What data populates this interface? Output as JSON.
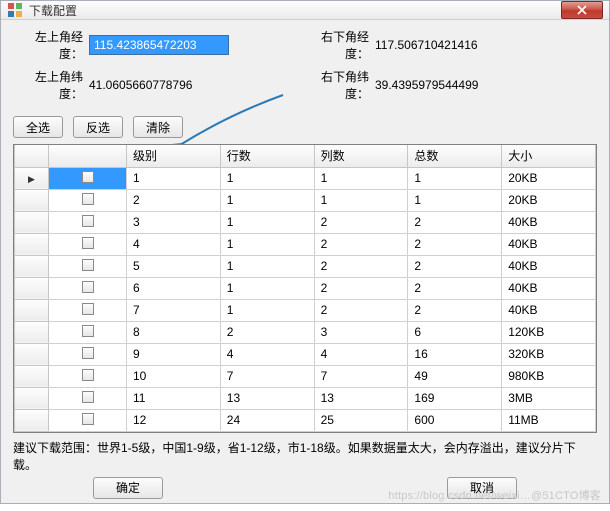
{
  "window": {
    "title": "下载配置"
  },
  "coords": {
    "tl_lon_label": "左上角经度：",
    "tl_lon_value": "115.423865472203",
    "tl_lat_label": "左上角纬度：",
    "tl_lat_value": "41.0605660778796",
    "br_lon_label": "右下角经度：",
    "br_lon_value": "117.506710421416",
    "br_lat_label": "右下角纬度：",
    "br_lat_value": "39.4395979544499"
  },
  "toolbar": {
    "select_all": "全选",
    "invert_select": "反选",
    "clear": "清除"
  },
  "table": {
    "headers": {
      "level": "级别",
      "rows": "行数",
      "cols": "列数",
      "total": "总数",
      "size": "大小"
    },
    "rows": [
      {
        "level": "1",
        "rows": "1",
        "cols": "1",
        "total": "1",
        "size": "20KB"
      },
      {
        "level": "2",
        "rows": "1",
        "cols": "1",
        "total": "1",
        "size": "20KB"
      },
      {
        "level": "3",
        "rows": "1",
        "cols": "2",
        "total": "2",
        "size": "40KB"
      },
      {
        "level": "4",
        "rows": "1",
        "cols": "2",
        "total": "2",
        "size": "40KB"
      },
      {
        "level": "5",
        "rows": "1",
        "cols": "2",
        "total": "2",
        "size": "40KB"
      },
      {
        "level": "6",
        "rows": "1",
        "cols": "2",
        "total": "2",
        "size": "40KB"
      },
      {
        "level": "7",
        "rows": "1",
        "cols": "2",
        "total": "2",
        "size": "40KB"
      },
      {
        "level": "8",
        "rows": "2",
        "cols": "3",
        "total": "6",
        "size": "120KB"
      },
      {
        "level": "9",
        "rows": "4",
        "cols": "4",
        "total": "16",
        "size": "320KB"
      },
      {
        "level": "10",
        "rows": "7",
        "cols": "7",
        "total": "49",
        "size": "980KB"
      },
      {
        "level": "11",
        "rows": "13",
        "cols": "13",
        "total": "169",
        "size": "3MB"
      },
      {
        "level": "12",
        "rows": "24",
        "cols": "25",
        "total": "600",
        "size": "11MB"
      }
    ]
  },
  "hint": "建议下载范围：世界1-5级，中国1-9级，省1-12级，市1-18级。如果数据量太大，会内存溢出，建议分片下载。",
  "buttons": {
    "ok": "确定",
    "cancel": "取消"
  },
  "watermark": "https://blog.csdn.net/weixi…@51CTO博客"
}
